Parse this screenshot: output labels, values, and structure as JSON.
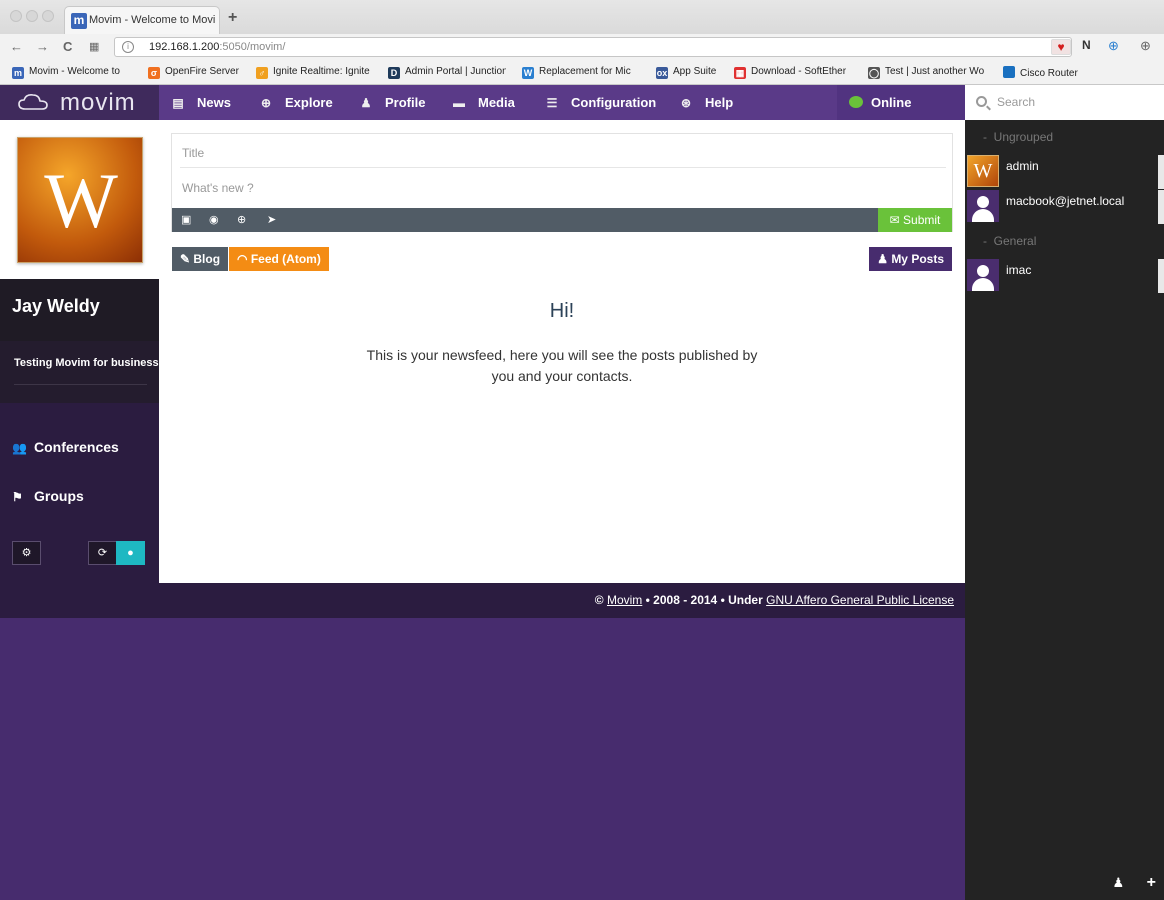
{
  "browser": {
    "tab_title": "Movim - Welcome to Movim",
    "new_tab": "+",
    "url_host": "192.168.1.200",
    "url_rest": ":5050/movim/",
    "bookmarks": [
      {
        "label": "Movim - Welcome to",
        "icon": "movim-icon",
        "color": "#3a66b8",
        "glyph": "m"
      },
      {
        "label": "OpenFire Server",
        "icon": "openfire-icon",
        "color": "#f07020",
        "glyph": "σ"
      },
      {
        "label": "Ignite Realtime: Ignite",
        "icon": "ignite-icon",
        "color": "#f0a020",
        "glyph": "♂"
      },
      {
        "label": "Admin Portal | Junction",
        "icon": "admin-portal-icon",
        "color": "#1e3a5a",
        "glyph": "D"
      },
      {
        "label": "Replacement for Mic",
        "icon": "replacement-icon",
        "color": "#2a7fd0",
        "glyph": "W"
      },
      {
        "label": "App Suite",
        "icon": "app-suite-icon",
        "color": "#3a5a9a",
        "glyph": "ox"
      },
      {
        "label": "Download - SoftEther",
        "icon": "download-icon",
        "color": "#e03030",
        "glyph": "▦"
      },
      {
        "label": "Test | Just another Wo",
        "icon": "wordpress-icon",
        "color": "#555",
        "glyph": "◯"
      },
      {
        "label": "Cisco Router",
        "icon": "cisco-icon",
        "color": "#1a70c0",
        "glyph": "((·))"
      }
    ]
  },
  "app": {
    "logo": "movim",
    "nav": [
      {
        "label": "News",
        "icon": "newspaper-icon"
      },
      {
        "label": "Explore",
        "icon": "globe-icon"
      },
      {
        "label": "Profile",
        "icon": "user-icon"
      },
      {
        "label": "Media",
        "icon": "folder-icon"
      },
      {
        "label": "Configuration",
        "icon": "sliders-icon"
      },
      {
        "label": "Help",
        "icon": "lifebuoy-icon"
      }
    ],
    "presence": "Online"
  },
  "profile": {
    "avatar_letter": "W",
    "name": "Jay Weldy",
    "status": "Testing Movim for business"
  },
  "sidebar": {
    "links": [
      {
        "label": "Conferences",
        "icon": "users-icon"
      },
      {
        "label": "Groups",
        "icon": "bookmark-icon"
      }
    ]
  },
  "composer": {
    "title_placeholder": "Title",
    "body_placeholder": "What's new ?",
    "submit_label": "Submit"
  },
  "feed": {
    "blog_label": "Blog",
    "atom_label": "Feed (Atom)",
    "my_posts_label": "My Posts",
    "greeting": "Hi!",
    "intro": "This is your newsfeed, here you will see the posts published by you and your contacts."
  },
  "roster": {
    "search_placeholder": "Search",
    "groups": [
      {
        "name": "Ungrouped",
        "contacts": [
          {
            "name": "admin",
            "avatar": "w"
          },
          {
            "name": "macbook@jetnet.local",
            "avatar": "user"
          }
        ]
      },
      {
        "name": "General",
        "contacts": [
          {
            "name": "imac",
            "avatar": "user"
          }
        ]
      }
    ]
  },
  "footer": {
    "copy": "©",
    "link1": "Movim",
    "middle": "• 2008 - 2014 • Under",
    "link2": "GNU Affero General Public License"
  },
  "colors": {
    "nav_bg": "#5a3a88",
    "sidebar_bg": "#2b1c40",
    "page_bg": "#472c6e",
    "submit_green": "#6ac23a",
    "atom_orange": "#f48c14",
    "teal": "#1eb8c2"
  }
}
